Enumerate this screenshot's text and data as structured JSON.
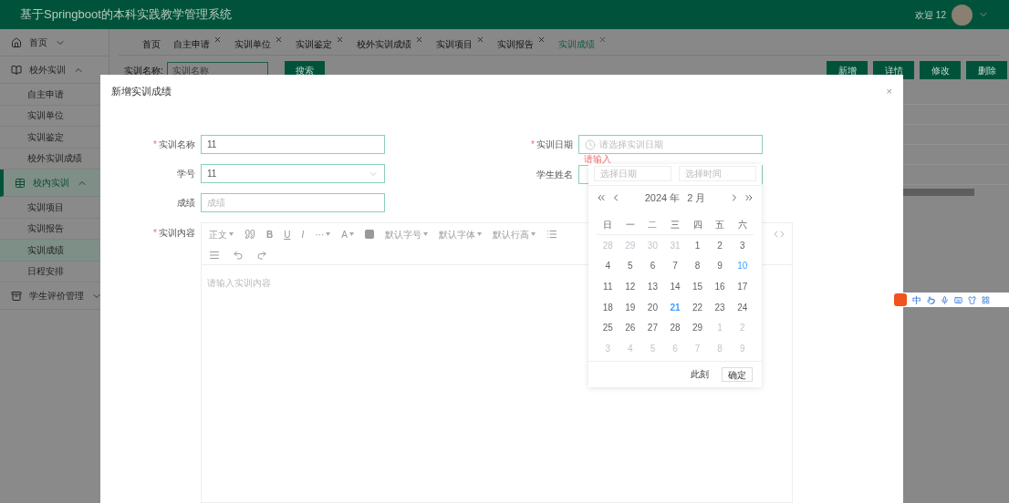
{
  "header": {
    "title": "基于Springboot的本科实践教学管理系统",
    "welcome": "欢迎 12"
  },
  "sidebar": {
    "items": [
      {
        "label": "首页",
        "expanded": false,
        "selected": false
      },
      {
        "label": "校外实训",
        "expanded": true,
        "selected": false,
        "children": [
          {
            "label": "自主申请",
            "selected": false
          },
          {
            "label": "实训单位",
            "selected": false
          },
          {
            "label": "实训鉴定",
            "selected": false
          },
          {
            "label": "校外实训成绩",
            "selected": false
          }
        ]
      },
      {
        "label": "校内实训",
        "expanded": true,
        "selected": true,
        "children": [
          {
            "label": "实训项目",
            "selected": false
          },
          {
            "label": "实训报告",
            "selected": false
          },
          {
            "label": "实训成绩",
            "selected": true
          },
          {
            "label": "日程安排",
            "selected": false
          }
        ]
      },
      {
        "label": "学生评价管理",
        "expanded": false,
        "selected": false
      }
    ]
  },
  "tabs": [
    {
      "label": "首页",
      "closable": false,
      "selected": false
    },
    {
      "label": "自主申请",
      "closable": true,
      "selected": false
    },
    {
      "label": "实训单位",
      "closable": true,
      "selected": false
    },
    {
      "label": "实训鉴定",
      "closable": true,
      "selected": false
    },
    {
      "label": "校外实训成绩",
      "closable": true,
      "selected": false
    },
    {
      "label": "实训项目",
      "closable": true,
      "selected": false
    },
    {
      "label": "实训报告",
      "closable": true,
      "selected": false
    },
    {
      "label": "实训成绩",
      "closable": true,
      "selected": true
    }
  ],
  "search": {
    "label": "实训名称:",
    "placeholder": "实训名称",
    "button": "搜索"
  },
  "actions": [
    "新增",
    "详情",
    "修改",
    "删除"
  ],
  "dialog": {
    "title": "新增实训成绩",
    "close": "×",
    "left_fields": [
      {
        "label": "实训名称",
        "required_mark": "*",
        "kind": "text",
        "value": "11"
      },
      {
        "label": "学号",
        "kind": "select",
        "value": "11"
      },
      {
        "label": "成绩",
        "kind": "text",
        "placeholder": "成绩"
      }
    ],
    "right_fields": [
      {
        "label": "实训日期",
        "required_mark": "*",
        "kind": "date",
        "placeholder": "请选择实训日期",
        "error": "请输入"
      },
      {
        "label": "学生姓名",
        "kind": "datetime"
      }
    ],
    "editor": {
      "label": "实训内容",
      "required_mark": "*",
      "placeholder": "请输入实训内容",
      "toolbar": {
        "format": "正文",
        "bold": "B",
        "underline": "U",
        "italic": "I",
        "more": "···",
        "font_color": "A",
        "font_size": "默认字号",
        "font_family": "默认字体",
        "line_height": "默认行高"
      }
    }
  },
  "date_picker": {
    "date_placeholder": "选择日期",
    "time_placeholder": "选择时间",
    "year": "2024 年",
    "month": "2 月",
    "weekdays": [
      "日",
      "一",
      "二",
      "三",
      "四",
      "五",
      "六"
    ],
    "weeks": [
      [
        {
          "day": "28",
          "kind": "other"
        },
        {
          "day": "29",
          "kind": "other"
        },
        {
          "day": "30",
          "kind": "other"
        },
        {
          "day": "31",
          "kind": "other"
        },
        {
          "day": "1",
          "kind": "normal"
        },
        {
          "day": "2",
          "kind": "normal"
        },
        {
          "day": "3",
          "kind": "normal"
        }
      ],
      [
        {
          "day": "4",
          "kind": "normal"
        },
        {
          "day": "5",
          "kind": "normal"
        },
        {
          "day": "6",
          "kind": "normal"
        },
        {
          "day": "7",
          "kind": "normal"
        },
        {
          "day": "8",
          "kind": "normal"
        },
        {
          "day": "9",
          "kind": "normal"
        },
        {
          "day": "10",
          "kind": "hover"
        }
      ],
      [
        {
          "day": "11",
          "kind": "normal"
        },
        {
          "day": "12",
          "kind": "normal"
        },
        {
          "day": "13",
          "kind": "normal"
        },
        {
          "day": "14",
          "kind": "normal"
        },
        {
          "day": "15",
          "kind": "normal"
        },
        {
          "day": "16",
          "kind": "normal"
        },
        {
          "day": "17",
          "kind": "normal"
        }
      ],
      [
        {
          "day": "18",
          "kind": "normal"
        },
        {
          "day": "19",
          "kind": "normal"
        },
        {
          "day": "20",
          "kind": "normal"
        },
        {
          "day": "21",
          "kind": "today"
        },
        {
          "day": "22",
          "kind": "normal"
        },
        {
          "day": "23",
          "kind": "normal"
        },
        {
          "day": "24",
          "kind": "normal"
        }
      ],
      [
        {
          "day": "25",
          "kind": "normal"
        },
        {
          "day": "26",
          "kind": "normal"
        },
        {
          "day": "27",
          "kind": "normal"
        },
        {
          "day": "28",
          "kind": "normal"
        },
        {
          "day": "29",
          "kind": "normal"
        },
        {
          "day": "1",
          "kind": "other"
        },
        {
          "day": "2",
          "kind": "other"
        }
      ],
      [
        {
          "day": "3",
          "kind": "other"
        },
        {
          "day": "4",
          "kind": "other"
        },
        {
          "day": "5",
          "kind": "other"
        },
        {
          "day": "6",
          "kind": "other"
        },
        {
          "day": "7",
          "kind": "other"
        },
        {
          "day": "8",
          "kind": "other"
        },
        {
          "day": "9",
          "kind": "other"
        }
      ]
    ],
    "now_button": "此刻",
    "confirm_button": "确定"
  },
  "ime_bar": {
    "mode": "中"
  }
}
